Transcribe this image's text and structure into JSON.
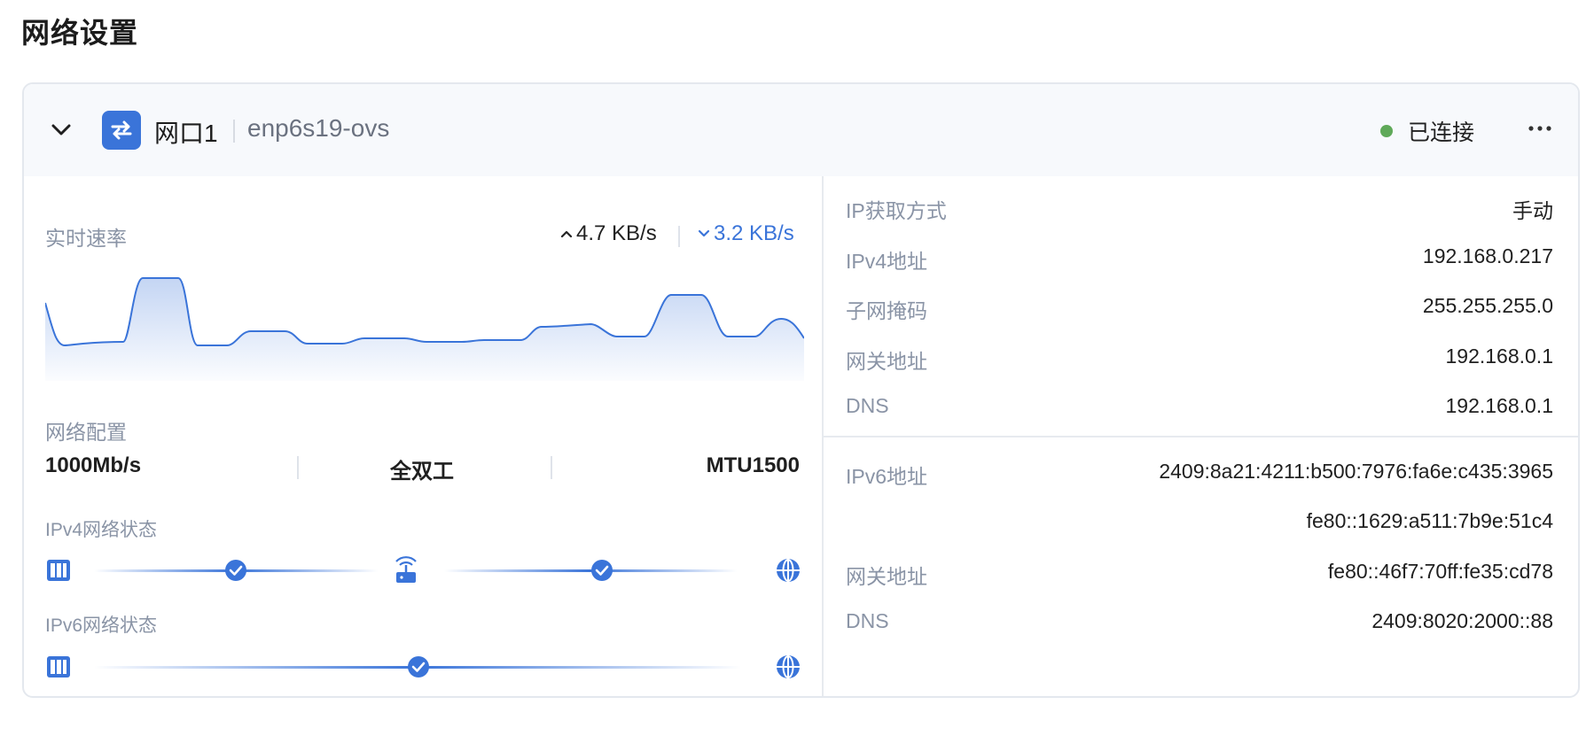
{
  "page": {
    "title": "网络设置"
  },
  "card": {
    "port_name": "网口1",
    "interface_name": "enp6s19-ovs",
    "status_text": "已连接",
    "colors": {
      "accent": "#3a74d9",
      "status_ok": "#5fa959"
    }
  },
  "speed": {
    "label": "实时速率",
    "upload": "4.7 KB/s",
    "download": "3.2 KB/s"
  },
  "net_config": {
    "label": "网络配置",
    "speed": "1000Mb/s",
    "duplex": "全双工",
    "mtu": "MTU1500"
  },
  "ipv4_status": {
    "label": "IPv4网络状态",
    "nodes": [
      "server-icon",
      "router-icon",
      "globe-icon"
    ],
    "links": [
      "ok",
      "ok"
    ]
  },
  "ipv6_status": {
    "label": "IPv6网络状态",
    "nodes": [
      "server-icon",
      "globe-icon"
    ],
    "links": [
      "ok"
    ]
  },
  "ipv4_info": {
    "rows": [
      {
        "label": "IP获取方式",
        "value": "手动"
      },
      {
        "label": "IPv4地址",
        "value": "192.168.0.217"
      },
      {
        "label": "子网掩码",
        "value": "255.255.255.0"
      },
      {
        "label": "网关地址",
        "value": "192.168.0.1"
      },
      {
        "label": "DNS",
        "value": "192.168.0.1"
      }
    ]
  },
  "ipv6_info": {
    "rows": [
      {
        "label": "IPv6地址",
        "value": "2409:8a21:4211:b500:7976:fa6e:c435:3965"
      },
      {
        "label": "",
        "value": "fe80::1629:a511:7b9e:51c4"
      },
      {
        "label": "网关地址",
        "value": "fe80::46f7:70ff:fe35:cd78"
      },
      {
        "label": "DNS",
        "value": "2409:8020:2000::88"
      }
    ]
  }
}
